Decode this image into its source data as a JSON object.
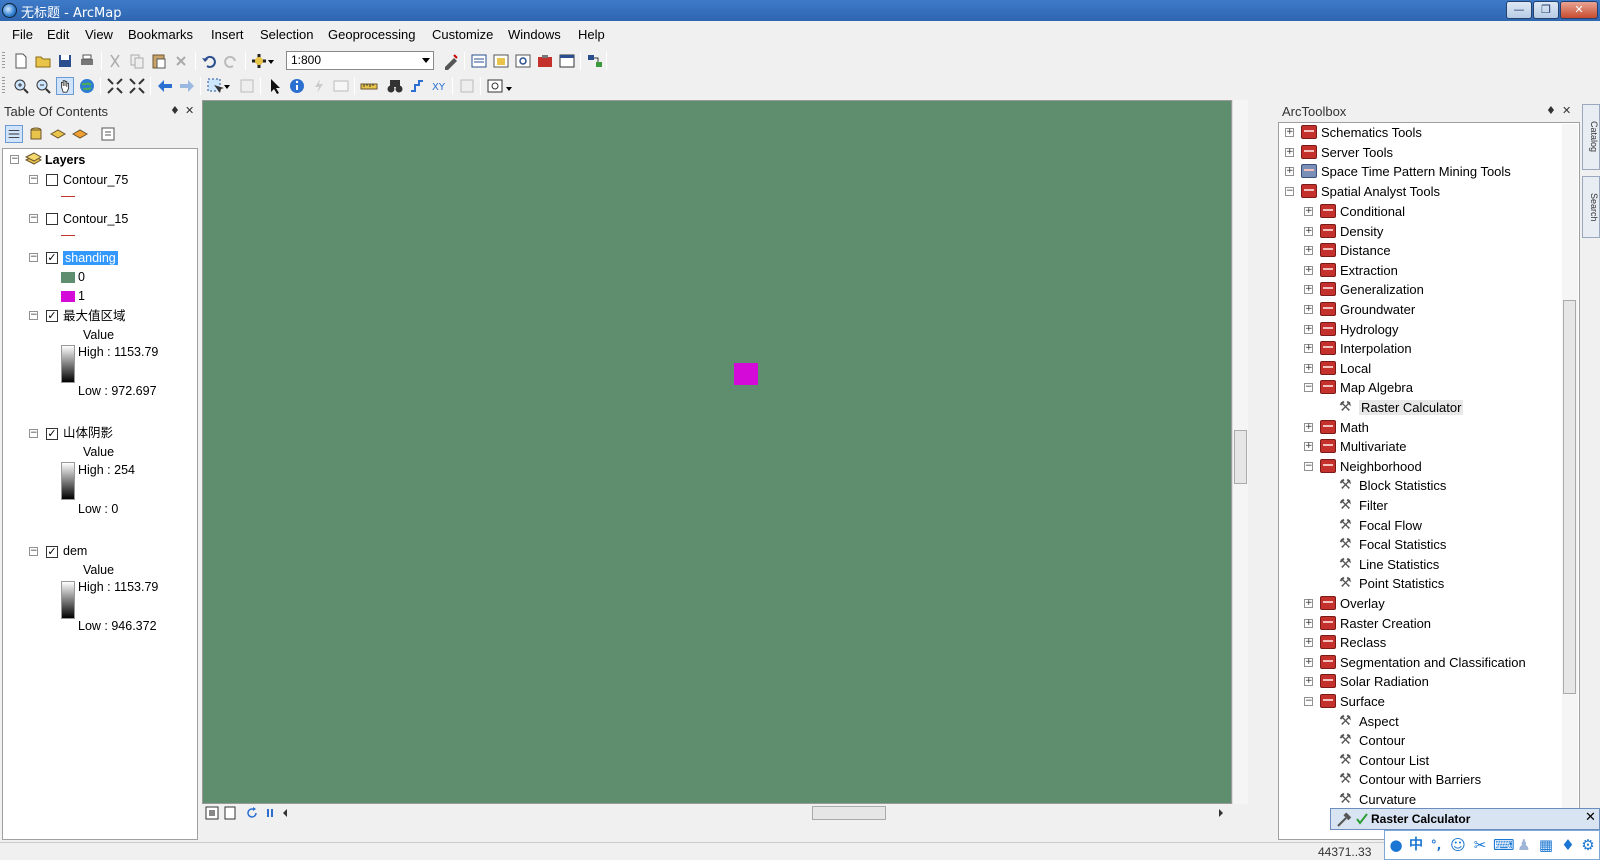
{
  "window": {
    "title": "无标题 - ArcMap",
    "minimize_glyph": "—",
    "restore_glyph": "❐",
    "close_glyph": "✕"
  },
  "menubar": [
    "File",
    "Edit",
    "View",
    "Bookmarks",
    "Insert",
    "Selection",
    "Geoprocessing",
    "Customize",
    "Windows",
    "Help"
  ],
  "standard_toolbar": {
    "scale": "1:800"
  },
  "toc": {
    "title": "Table Of Contents",
    "pin_glyph": "♦",
    "close_glyph": "✕",
    "root": "Layers",
    "layers": {
      "contour75": {
        "name": "Contour_75",
        "checked": false,
        "line_color": "#c0392b"
      },
      "contour15": {
        "name": "Contour_15",
        "checked": false,
        "line_color": "#c0392b"
      },
      "shanding": {
        "name": "shanding",
        "checked": true,
        "selected": true,
        "classes": [
          {
            "label": "0",
            "color": "#5e8e6e"
          },
          {
            "label": "1",
            "color": "#d40ad9"
          }
        ]
      },
      "maxregion": {
        "name": "最大值区域",
        "checked": true,
        "field": "Value",
        "high": "High : 1153.79",
        "low": "Low : 972.697"
      },
      "hillshade": {
        "name": "山体阴影",
        "checked": true,
        "field": "Value",
        "high": "High : 254",
        "low": "Low : 0"
      },
      "dem": {
        "name": "dem",
        "checked": true,
        "field": "Value",
        "high": "High : 1153.79",
        "low": "Low : 946.372"
      }
    }
  },
  "map": {
    "background_color": "#5e8e6e",
    "cell_color": "#d40ad9"
  },
  "arctoolbox": {
    "title": "ArcToolbox",
    "items": {
      "schematics": "Schematics Tools",
      "server": "Server Tools",
      "spacetime": "Space Time Pattern Mining Tools",
      "spatial": "Spatial Analyst Tools",
      "conditional": "Conditional",
      "density": "Density",
      "distance": "Distance",
      "extraction": "Extraction",
      "generalization": "Generalization",
      "groundwater": "Groundwater",
      "hydrology": "Hydrology",
      "interpolation": "Interpolation",
      "local": "Local",
      "mapalgebra": "Map Algebra",
      "rastercalc": "Raster Calculator",
      "math": "Math",
      "multivariate": "Multivariate",
      "neighborhood": "Neighborhood",
      "blockstats": "Block Statistics",
      "filter": "Filter",
      "focalflow": "Focal Flow",
      "focalstats": "Focal Statistics",
      "linestats": "Line Statistics",
      "pointstats": "Point Statistics",
      "overlay": "Overlay",
      "rastercreation": "Raster Creation",
      "reclass": "Reclass",
      "segmentation": "Segmentation and Classification",
      "solar": "Solar Radiation",
      "surface": "Surface",
      "aspect": "Aspect",
      "contour": "Contour",
      "contourlist": "Contour List",
      "contourbarriers": "Contour with Barriers",
      "curvature": "Curvature"
    }
  },
  "side_tabs": [
    "Catalog",
    "Search"
  ],
  "status": {
    "coordinates": "44371..33"
  },
  "floating": {
    "title": "Raster Calculator"
  },
  "ime": {
    "lang": "中",
    "punct": "°,"
  }
}
